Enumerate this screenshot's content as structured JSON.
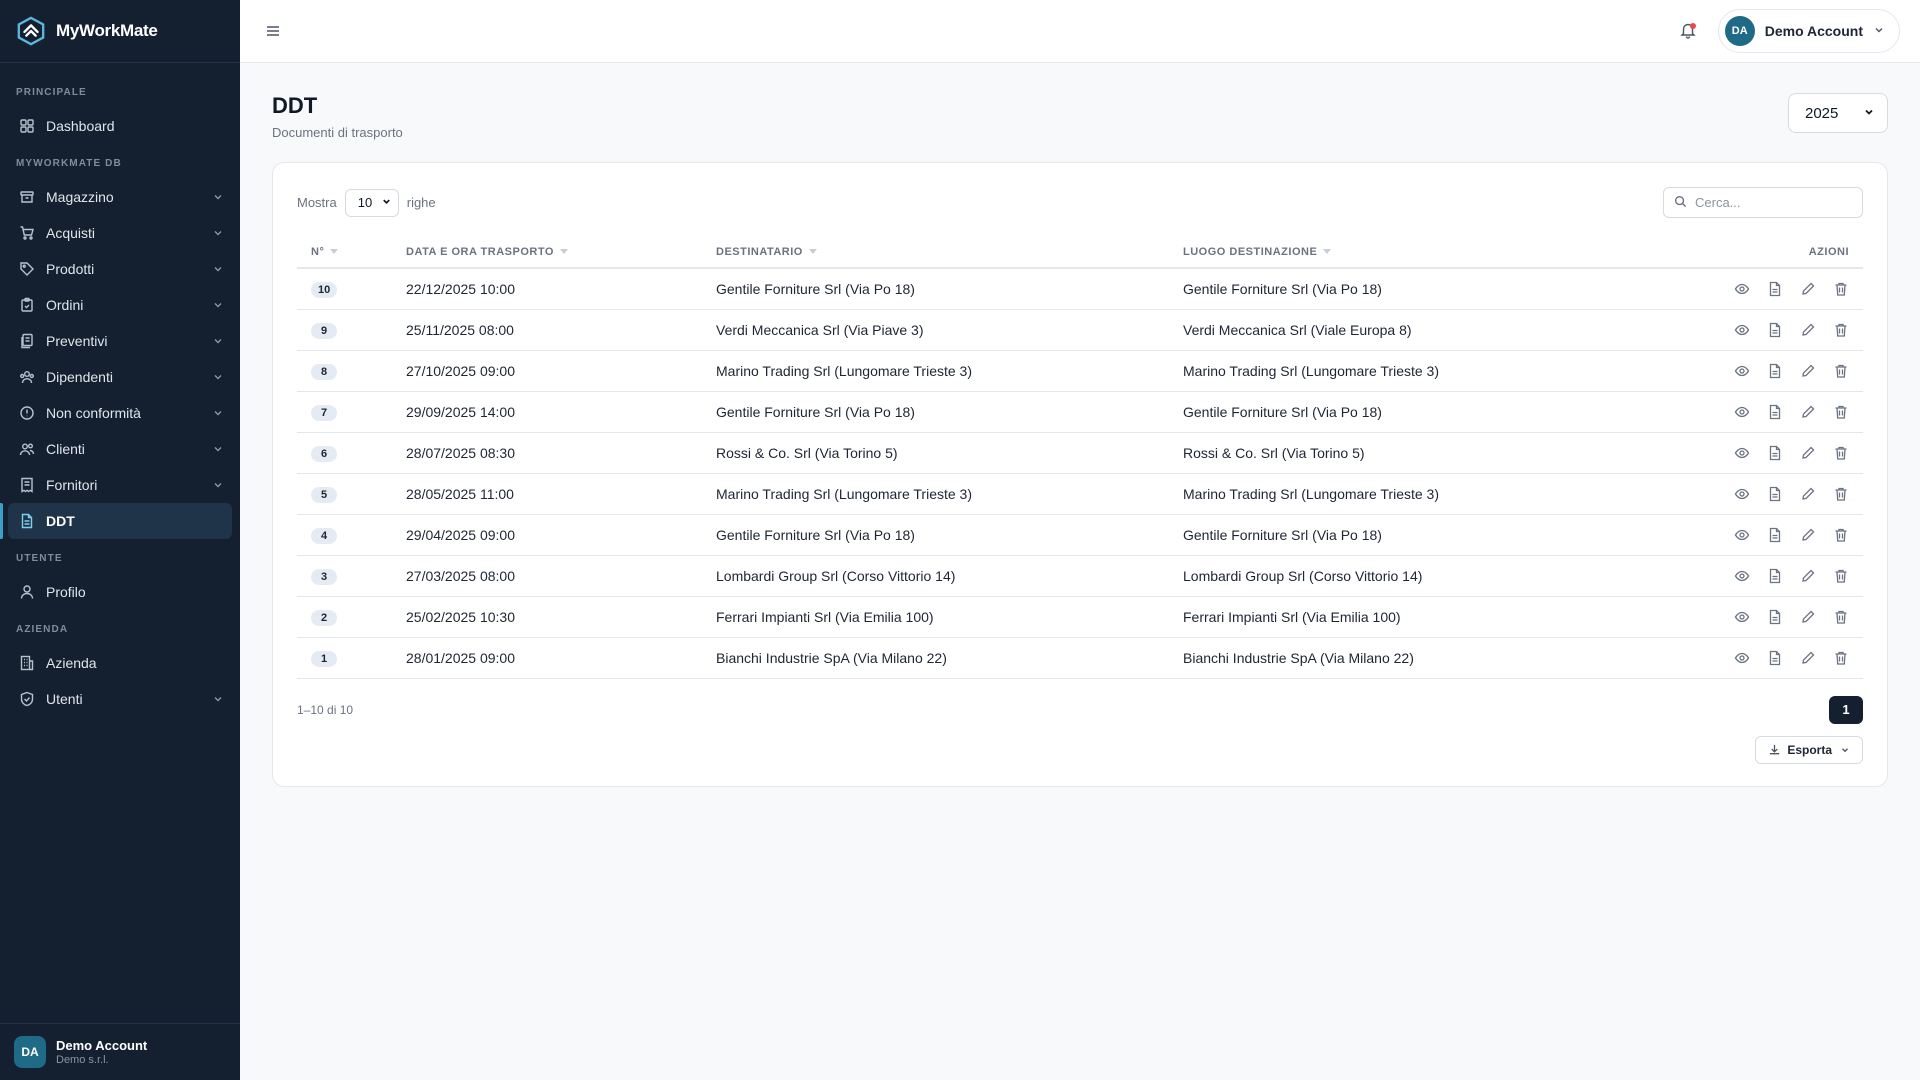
{
  "brand": {
    "name": "MyWorkMate"
  },
  "sidebar": {
    "sections": {
      "principale": "PRINCIPALE",
      "db": "MYWORKMATE DB",
      "utente": "UTENTE",
      "azienda": "AZIENDA"
    },
    "items": {
      "dashboard": "Dashboard",
      "magazzino": "Magazzino",
      "acquisti": "Acquisti",
      "prodotti": "Prodotti",
      "ordini": "Ordini",
      "preventivi": "Preventivi",
      "dipendenti": "Dipendenti",
      "non_conformita": "Non conformità",
      "clienti": "Clienti",
      "fornitori": "Fornitori",
      "ddt": "DDT",
      "profilo": "Profilo",
      "azienda": "Azienda",
      "utenti": "Utenti"
    },
    "active": "DDT",
    "user": {
      "initials": "DA",
      "name": "Demo Account",
      "company": "Demo s.r.l."
    }
  },
  "topbar": {
    "account_initials": "DA",
    "account_name": "Demo Account"
  },
  "page": {
    "title": "DDT",
    "subtitle": "Documenti di trasporto",
    "year": "2025"
  },
  "table_controls": {
    "show_label": "Mostra",
    "rows_value": "10",
    "rows_label": "righe",
    "search_placeholder": "Cerca..."
  },
  "table": {
    "headers": {
      "num": "N°",
      "date": "DATA E ORA TRASPORTO",
      "recipient": "DESTINATARIO",
      "destination": "LUOGO DESTINAZIONE",
      "actions": "AZIONI"
    },
    "rows": [
      {
        "num": "10",
        "date": "22/12/2025 10:00",
        "recipient": "Gentile Forniture Srl (Via Po 18)",
        "destination": "Gentile Forniture Srl (Via Po 18)"
      },
      {
        "num": "9",
        "date": "25/11/2025 08:00",
        "recipient": "Verdi Meccanica Srl (Via Piave 3)",
        "destination": "Verdi Meccanica Srl (Viale Europa 8)"
      },
      {
        "num": "8",
        "date": "27/10/2025 09:00",
        "recipient": "Marino Trading Srl (Lungomare Trieste 3)",
        "destination": "Marino Trading Srl (Lungomare Trieste 3)"
      },
      {
        "num": "7",
        "date": "29/09/2025 14:00",
        "recipient": "Gentile Forniture Srl (Via Po 18)",
        "destination": "Gentile Forniture Srl (Via Po 18)"
      },
      {
        "num": "6",
        "date": "28/07/2025 08:30",
        "recipient": "Rossi & Co. Srl (Via Torino 5)",
        "destination": "Rossi & Co. Srl (Via Torino 5)"
      },
      {
        "num": "5",
        "date": "28/05/2025 11:00",
        "recipient": "Marino Trading Srl (Lungomare Trieste 3)",
        "destination": "Marino Trading Srl (Lungomare Trieste 3)"
      },
      {
        "num": "4",
        "date": "29/04/2025 09:00",
        "recipient": "Gentile Forniture Srl (Via Po 18)",
        "destination": "Gentile Forniture Srl (Via Po 18)"
      },
      {
        "num": "3",
        "date": "27/03/2025 08:00",
        "recipient": "Lombardi Group Srl (Corso Vittorio 14)",
        "destination": "Lombardi Group Srl (Corso Vittorio 14)"
      },
      {
        "num": "2",
        "date": "25/02/2025 10:30",
        "recipient": "Ferrari Impianti Srl (Via Emilia 100)",
        "destination": "Ferrari Impianti Srl (Via Emilia 100)"
      },
      {
        "num": "1",
        "date": "28/01/2025 09:00",
        "recipient": "Bianchi Industrie SpA (Via Milano 22)",
        "destination": "Bianchi Industrie SpA (Via Milano 22)"
      }
    ]
  },
  "footer": {
    "range": "1–10 di 10",
    "current_page": "1",
    "export_label": "Esporta"
  },
  "colors": {
    "sidebar_bg": "#14202f",
    "accent": "#1f6a86",
    "active_bar": "#3aa0c8"
  }
}
